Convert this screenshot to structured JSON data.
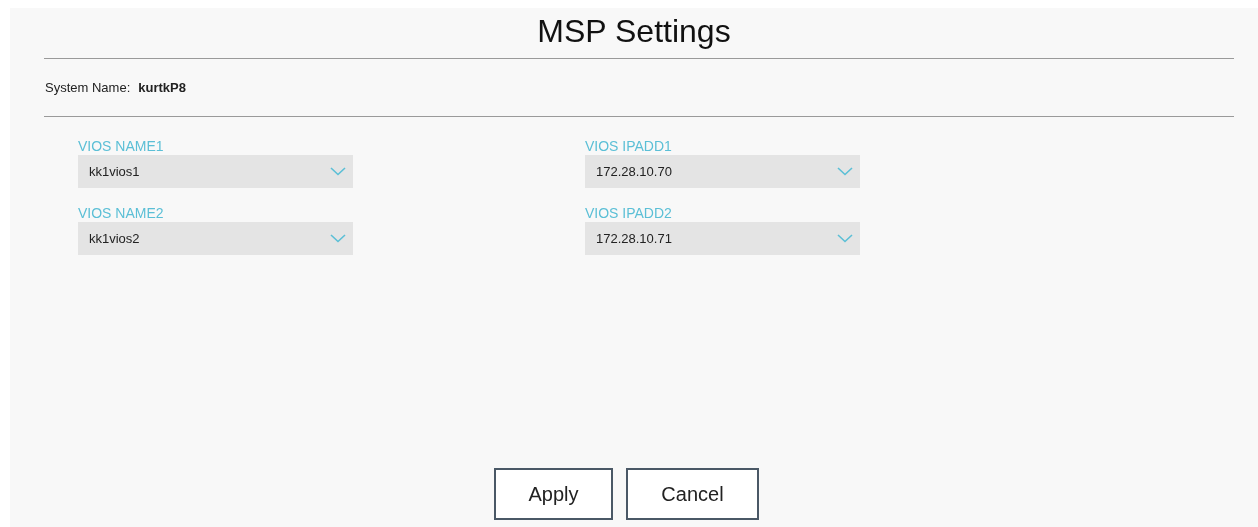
{
  "title": "MSP Settings",
  "system_name": {
    "label": "System Name:",
    "value": "kurtkP8"
  },
  "fields": [
    {
      "label": "VIOS NAME1",
      "value": "kk1vios1"
    },
    {
      "label": "VIOS IPADD1",
      "value": "172.28.10.70"
    },
    {
      "label": "VIOS NAME2",
      "value": "kk1vios2"
    },
    {
      "label": "VIOS IPADD2",
      "value": "172.28.10.71"
    }
  ],
  "buttons": [
    "Apply",
    "Cancel"
  ]
}
